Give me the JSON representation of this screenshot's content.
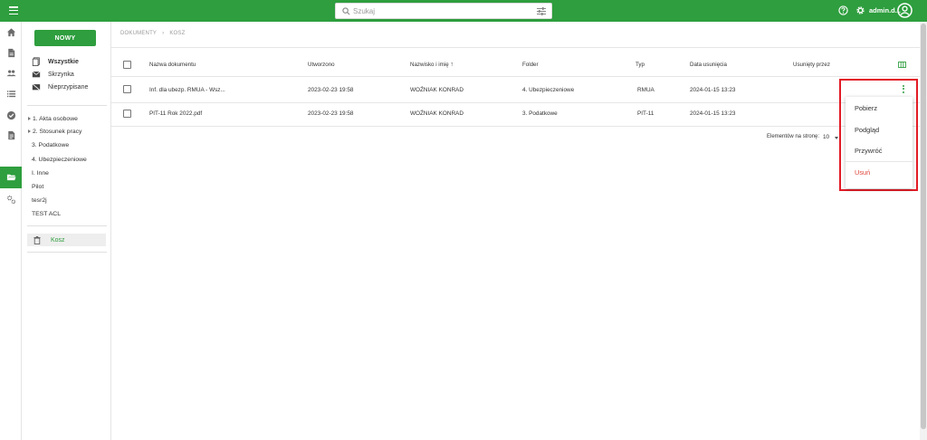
{
  "topbar": {
    "search_placeholder": "Szukaj",
    "username": "admin.d..."
  },
  "sidebar": {
    "new_button": "NOWY",
    "nav": [
      {
        "label": "Wszystkie"
      },
      {
        "label": "Skrzynka"
      },
      {
        "label": "Nieprzypisane"
      }
    ],
    "folders": [
      {
        "label": "1. Akta osobowe"
      },
      {
        "label": "2. Stosunek pracy"
      },
      {
        "label": "3. Podatkowe"
      },
      {
        "label": "4. Ubezpieczeniowe"
      },
      {
        "label": "I. Inne"
      },
      {
        "label": "Pilot"
      },
      {
        "label": "tesr2j"
      },
      {
        "label": "TEST ACL"
      }
    ],
    "trash": "Kosz"
  },
  "breadcrumb": {
    "root": "DOKUMENTY",
    "current": "KOSZ"
  },
  "table": {
    "columns": [
      "Nazwa dokumentu",
      "Utworzono",
      "Nazwisko i imię",
      "Folder",
      "Typ",
      "Data usunięcia",
      "Usunięty przez"
    ],
    "rows": [
      {
        "name": "Inf. dla ubezp. RMUA - Wsz...",
        "created": "2023-02-23 19:58",
        "person": "WOŹNIAK KONRAD",
        "folder": "4. Ubezpieczeniowe",
        "type": "RMUA",
        "deleted": "2024-01-15 13:23"
      },
      {
        "name": "PIT-11 Rok 2022.pdf",
        "created": "2023-02-23 19:58",
        "person": "WOŹNIAK KONRAD",
        "folder": "3. Podatkowe",
        "type": "PIT-11",
        "deleted": "2024-01-15 13:23"
      }
    ]
  },
  "pagination": {
    "label": "Elementów na stronę:",
    "value": "10"
  },
  "context_menu": {
    "items": [
      {
        "label": "Pobierz"
      },
      {
        "label": "Podgląd"
      },
      {
        "label": "Przywróć"
      },
      {
        "label": "Usuń"
      }
    ]
  },
  "colors": {
    "primary": "#2e9e3e",
    "danger": "#e0463c",
    "highlight": "#e21b25"
  }
}
